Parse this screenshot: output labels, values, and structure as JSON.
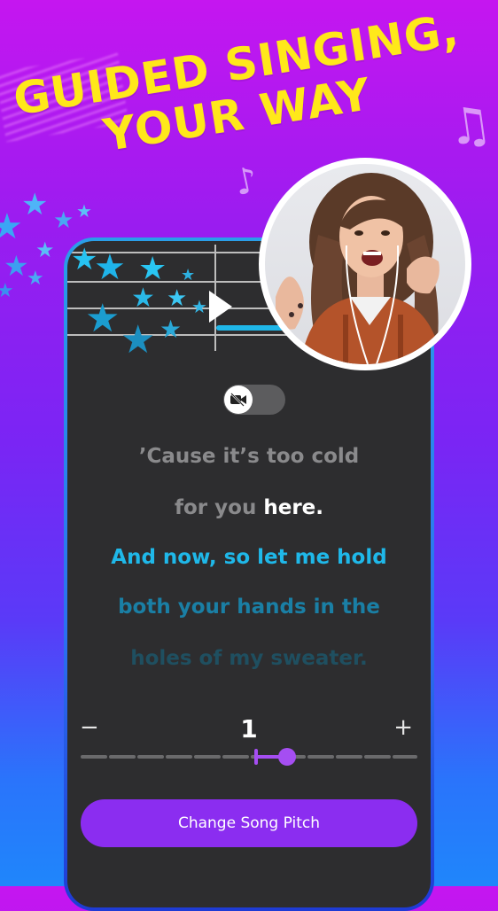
{
  "promo": {
    "headline_line1": "GUIDED SINGING,",
    "headline_line2": "YOUR WAY"
  },
  "icons": {
    "camera_off": "video-off-icon",
    "music_note": "music-note-icon",
    "play": "play-icon",
    "star": "star-icon"
  },
  "lyrics": {
    "line1": "’Cause it’s too cold",
    "line2_past": "for you ",
    "line2_current": "here.",
    "line3": "And now, so let me hold",
    "line4": "both your hands in the",
    "line5": "holes of my sweater."
  },
  "pitch": {
    "minus_label": "−",
    "value": "1",
    "plus_label": "+",
    "slider_value": 1
  },
  "actions": {
    "change_pitch_label": "Change Song Pitch"
  },
  "colors": {
    "background_top": "#c516f0",
    "background_bottom": "#1f86fb",
    "headline": "#ffe81a",
    "accent_purple": "#8b2df0",
    "lyric_active": "#1fb8e9",
    "star": "#27c3f2"
  }
}
